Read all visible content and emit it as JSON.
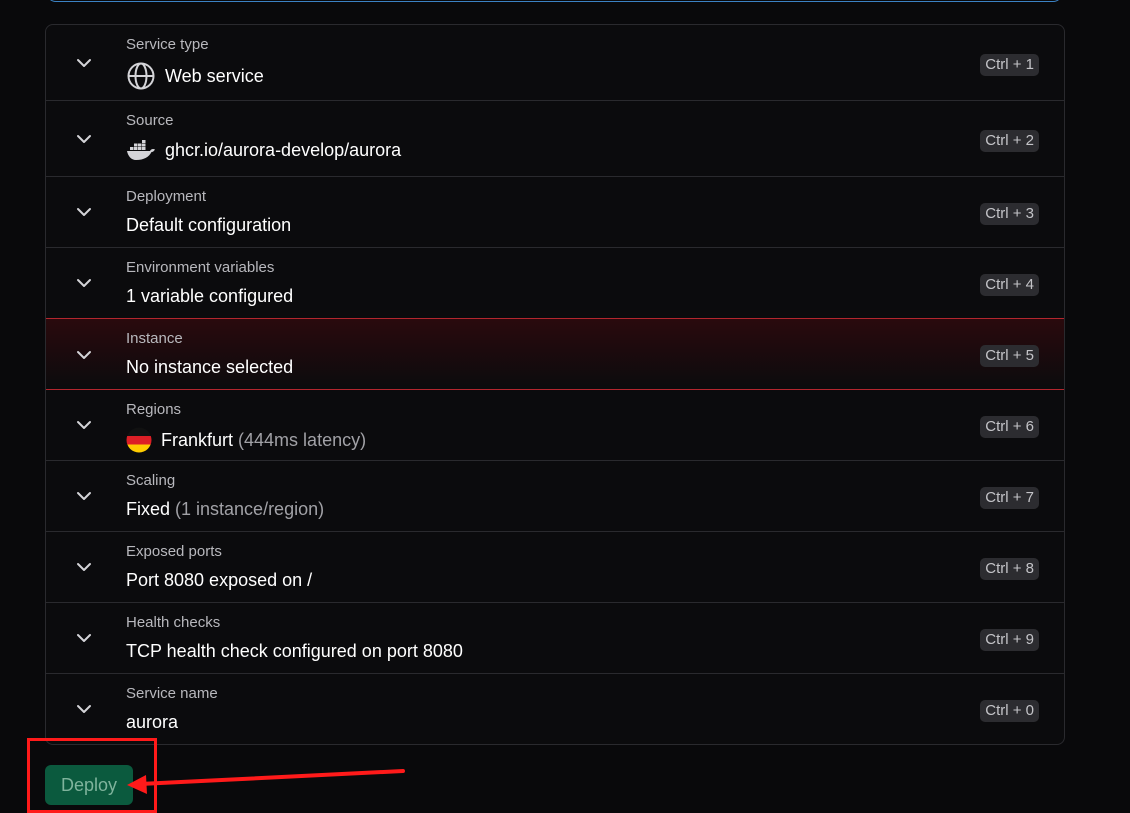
{
  "rows": [
    {
      "label": "Service type",
      "value": "Web service",
      "shortcut": "Ctrl + 1"
    },
    {
      "label": "Source",
      "value": "ghcr.io/aurora-develop/aurora",
      "shortcut": "Ctrl + 2"
    },
    {
      "label": "Deployment",
      "value": "Default configuration",
      "shortcut": "Ctrl + 3"
    },
    {
      "label": "Environment variables",
      "value": "1 variable configured",
      "shortcut": "Ctrl + 4"
    },
    {
      "label": "Instance",
      "value": "No instance selected",
      "shortcut": "Ctrl + 5"
    },
    {
      "label": "Regions",
      "value": "Frankfurt",
      "detail": "(444ms latency)",
      "shortcut": "Ctrl + 6"
    },
    {
      "label": "Scaling",
      "value": "Fixed",
      "detail": "(1 instance/region)",
      "shortcut": "Ctrl + 7"
    },
    {
      "label": "Exposed ports",
      "value": "Port 8080 exposed on /",
      "shortcut": "Ctrl + 8"
    },
    {
      "label": "Health checks",
      "value": "TCP health check configured on port 8080",
      "shortcut": "Ctrl + 9"
    },
    {
      "label": "Service name",
      "value": "aurora",
      "shortcut": "Ctrl + 0"
    }
  ],
  "deploy": {
    "label": "Deploy"
  },
  "colors": {
    "background": "#09090b",
    "panel_border": "#2a2a2e",
    "error_border": "#b3262e",
    "deploy_bg": "#0b5a3e",
    "annotation": "#ff1a1a"
  },
  "icons": {
    "service_type": "globe-icon",
    "source": "docker-icon",
    "region": "germany-flag-icon",
    "expand": "chevron-down-icon"
  }
}
